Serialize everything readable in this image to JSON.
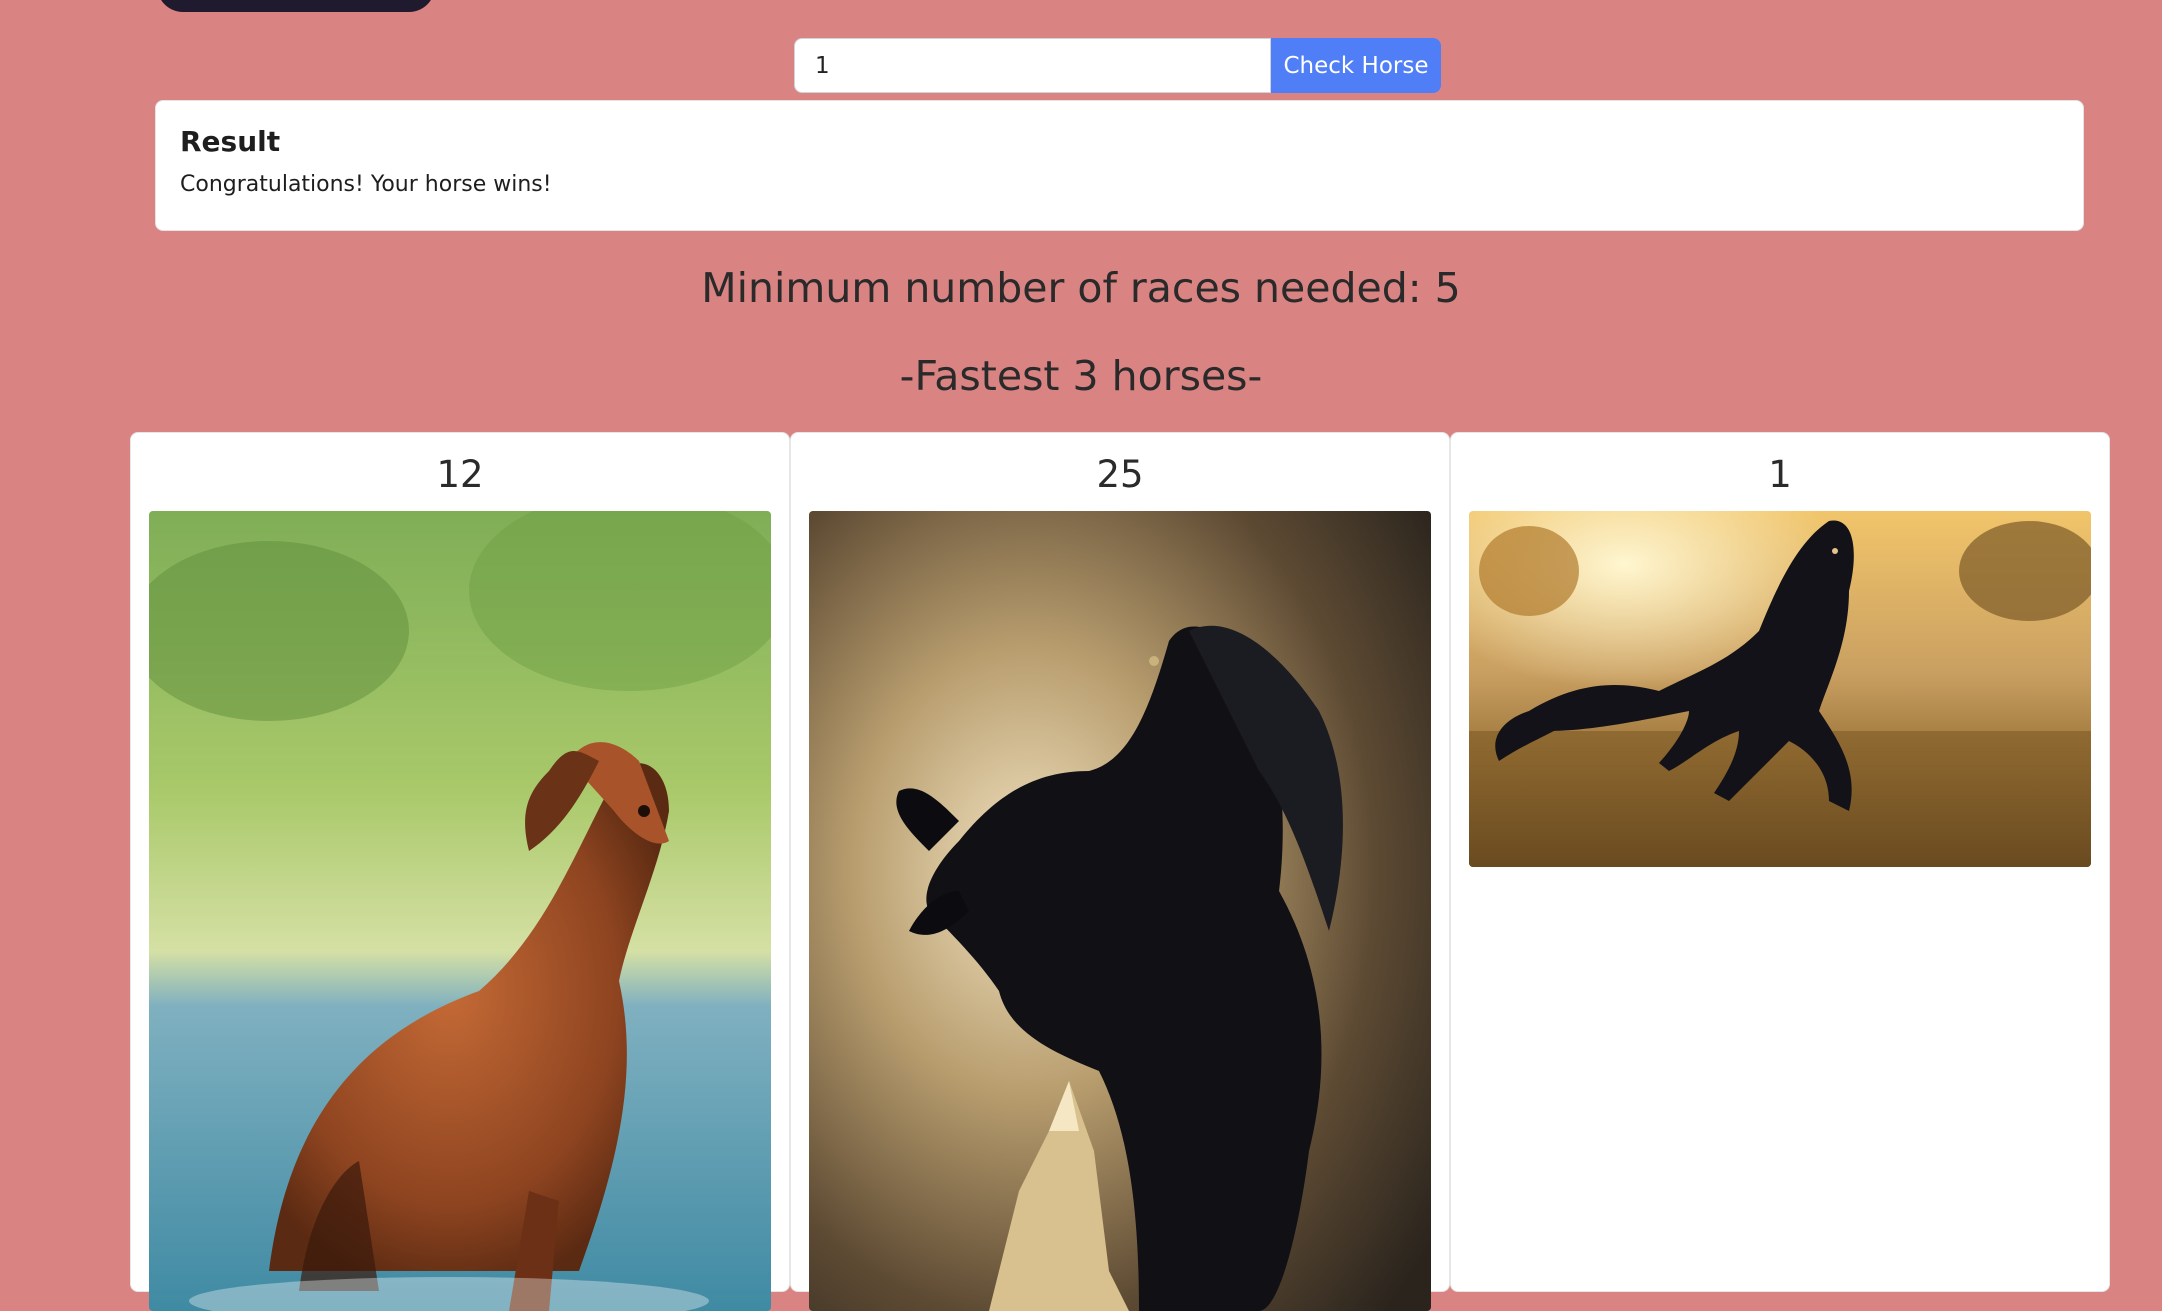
{
  "search": {
    "value": "1",
    "button_label": "Check Horse"
  },
  "result": {
    "title": "Result",
    "message": "Congratulations! Your horse wins!"
  },
  "headings": {
    "races": "Minimum number of races needed: 5",
    "fastest": "-Fastest 3 horses-"
  },
  "horses": [
    {
      "number": "12",
      "image": "chestnut-horse-running-in-water"
    },
    {
      "number": "25",
      "image": "black-horse-rearing-storm"
    },
    {
      "number": "1",
      "image": "black-horse-galloping-field-sunset"
    }
  ],
  "colors": {
    "page_background": "#d98483",
    "button": "#4f7ef7",
    "top_pill": "#1f1a2e"
  }
}
